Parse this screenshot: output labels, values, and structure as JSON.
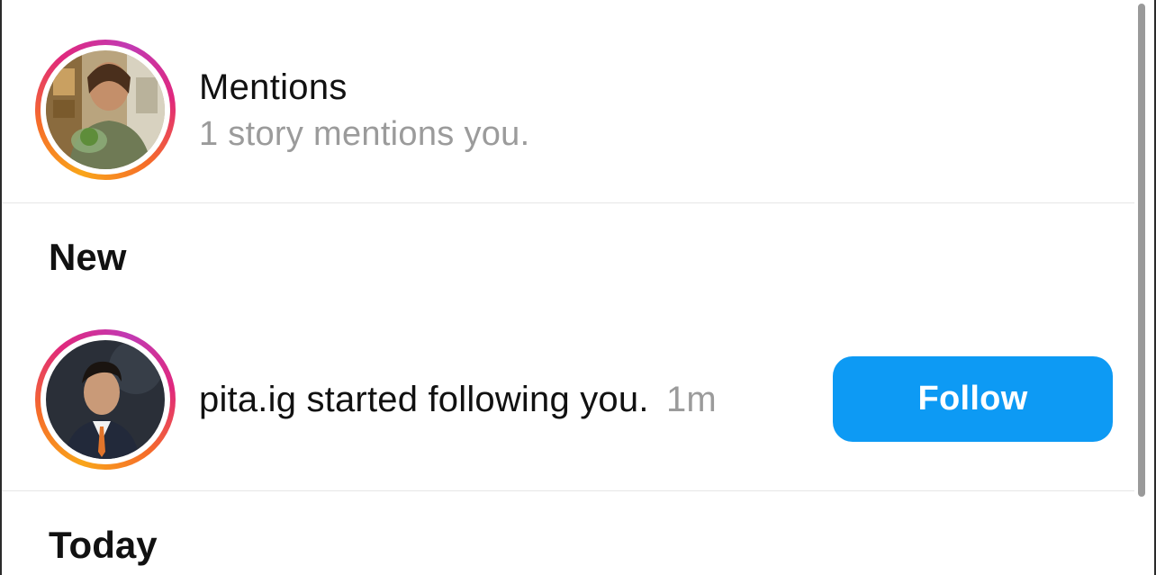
{
  "mentions": {
    "title": "Mentions",
    "subtitle": "1 story mentions you."
  },
  "sections": {
    "new": "New",
    "today": "Today"
  },
  "notifications": [
    {
      "username": "pita.ig",
      "action": "started following you.",
      "time": "1m",
      "button_label": "Follow"
    }
  ],
  "colors": {
    "follow_button": "#0d9af4",
    "secondary_text": "#9b9b9b",
    "story_ring": [
      "#f9a51a",
      "#f56b2a",
      "#e0287d",
      "#c13ab4"
    ]
  }
}
